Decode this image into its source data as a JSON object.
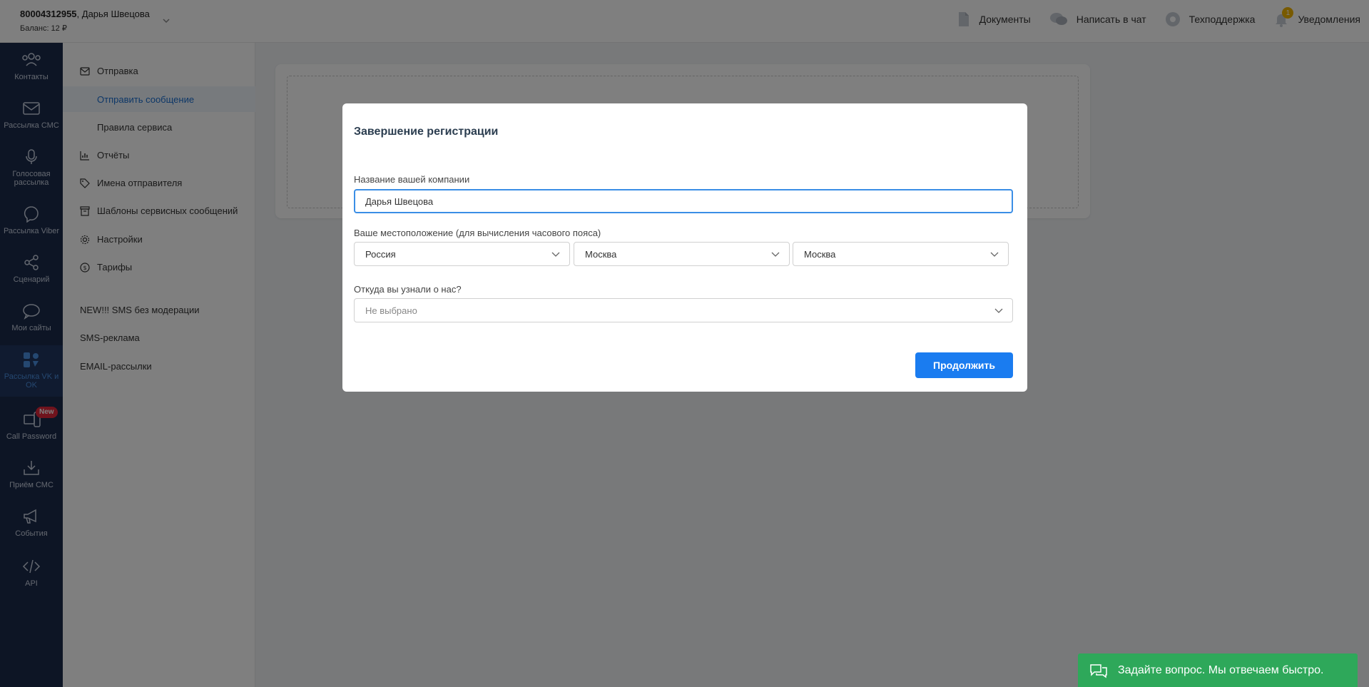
{
  "account": {
    "phone": "80004312955",
    "separator": ", ",
    "name": "Дарья Швецова",
    "balance": "Баланс: 12 ₽"
  },
  "topnav": {
    "documents": "Документы",
    "chat": "Написать в чат",
    "support": "Техподдержка",
    "notifications": "Уведомления",
    "notifications_count": "1"
  },
  "rail": {
    "contacts": "Контакты",
    "sms": "Рассылка СМС",
    "voice": "Голосовая рассылка",
    "viber": "Рассылка Viber",
    "scenarios": "Сценарий",
    "sites": "Мои сайты",
    "vk": "Рассылка VK и OK",
    "callpassword": "Call Password",
    "callpassword_badge": "New",
    "receive": "Приём СМС",
    "events": "События",
    "api": "API"
  },
  "menu": {
    "send": "Отправка",
    "send_message": "Отправить сообщение",
    "rules": "Правила сервиса",
    "reports": "Отчёты",
    "sender_names": "Имена отправителя",
    "templates": "Шаблоны сервисных сообщений",
    "settings": "Настройки",
    "tariffs": "Тарифы",
    "sms_no_moderation": "NEW!!! SMS без модерации",
    "sms_ads": "SMS-реклама",
    "email": "EMAIL-рассылки"
  },
  "modal": {
    "title": "Завершение регистрации",
    "company_label": "Название вашей компании",
    "company_value": "Дарья Швецова",
    "location_label": "Ваше местоположение (для вычисления часового пояса)",
    "country": "Россия",
    "region": "Москва",
    "city": "Москва",
    "source_label": "Откуда вы узнали о нас?",
    "source_placeholder": "Не выбрано",
    "continue": "Продолжить"
  },
  "chat_widget": {
    "text": "Задайте вопрос. Мы отвечаем быстро."
  },
  "colors": {
    "rail_bg": "#1a2a4a",
    "accent": "#1a7cf0",
    "chat_green": "#2ea85a",
    "badge_red": "#e0273a",
    "notif_yellow": "#f0b400"
  }
}
